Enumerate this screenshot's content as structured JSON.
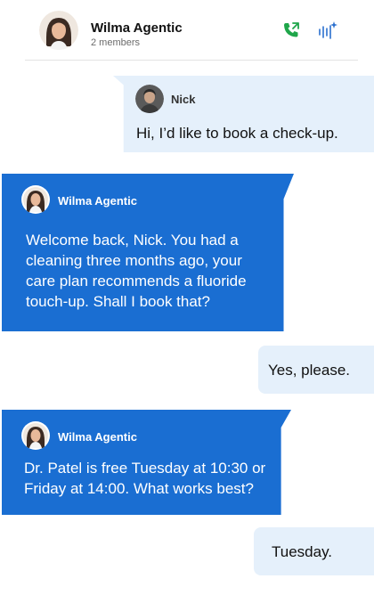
{
  "header": {
    "title": "Wilma Agentic",
    "subtitle": "2 members",
    "call_icon": "phone-icon",
    "voice_icon": "voice-ai-icon"
  },
  "colors": {
    "agent_bubble": "#1a6ed2",
    "user_bubble": "#e5f0fb",
    "call_icon": "#1fa64a",
    "voice_icon": "#2a6fce"
  },
  "messages": [
    {
      "sender": "Nick",
      "role": "user",
      "text": "Hi, I’d like to book a check-up."
    },
    {
      "sender": "Wilma Agentic",
      "role": "agent",
      "lines": [
        "Welcome back, Nick. You had a",
        "cleaning three months ago, your",
        "care plan recommends a fluoride",
        "touch-up. Shall I book that?"
      ]
    },
    {
      "role": "user",
      "text": "Yes, please."
    },
    {
      "sender": "Wilma Agentic",
      "role": "agent",
      "lines": [
        "Dr. Patel is free Tuesday at 10:30 or",
        "Friday at 14:00. What works best?"
      ]
    },
    {
      "role": "user",
      "text": "Tuesday."
    }
  ]
}
